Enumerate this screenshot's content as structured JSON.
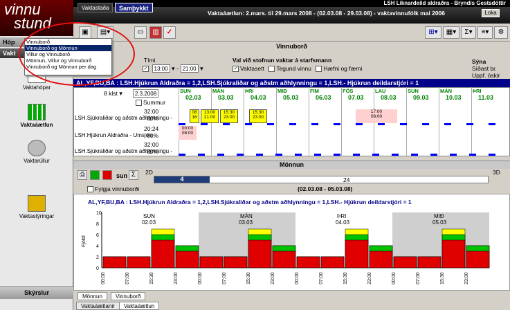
{
  "app": {
    "logo_line1": "vinnu",
    "logo_line2": "stund",
    "window_title": "LSH Líknardeild aldraðra - Bryndís Gestsdóttir"
  },
  "sidebar": {
    "section_home": "Hóp",
    "section_active": "Vakt",
    "items": [
      {
        "label": "Vaktahópar"
      },
      {
        "label": "Vaktaáætlun"
      },
      {
        "label": "Vaktarúllur"
      },
      {
        "label": "Vaktastýringar"
      }
    ],
    "footer": "Skýrslur"
  },
  "tabs": {
    "vaktastada": "Vaktastaða",
    "samthykkt": "Samþykkt"
  },
  "period_title": "Vaktaáætlun: 2.mars. til 29.mars 2008 - (02.03.08 - 29.03.08) - vaktavinnufólk mai 2006",
  "close_label": "Loka",
  "menu": {
    "items": [
      "Vinnuborð",
      "Vinnuborð og Mönnun",
      "Villur og Vinnuborð",
      "Mönnun, Villur og Vinnuborð",
      "Vinnuborð og Mönnun per dag"
    ],
    "selected_index": 1
  },
  "filter": {
    "title": "Vinnuborð",
    "time_label": "Tími",
    "time_from": "13:00",
    "time_to": "21:00",
    "staff_group_label": "Val við stofnun vaktar á starfsmann",
    "opts": [
      "Vaktasett",
      "Tegund vinnu",
      "Hæfni og færni"
    ],
    "show_label": "Sýna",
    "show_opts": [
      "Síðast br.",
      "Uppf. óskir"
    ],
    "weeks": "8 klst",
    "date": "2.3.2008",
    "summary_label": "Summur"
  },
  "banner_top": "AL,YF,BU,BA : LSH.Hjúkrun Aldraðra = 1,2,LSH.Sjúkraliðar og aðstm aðhlynningu = 1,LSH.- Hjúkrun deildarstjóri = 1",
  "days": [
    {
      "d": "SUN",
      "n": "02.03"
    },
    {
      "d": "MÁN",
      "n": "03.03"
    },
    {
      "d": "ÞRI",
      "n": "04.03"
    },
    {
      "d": "MIÐ",
      "n": "05.03"
    },
    {
      "d": "FIM",
      "n": "06.03"
    },
    {
      "d": "FÖS",
      "n": "07.03"
    },
    {
      "d": "LAU",
      "n": "08.03"
    },
    {
      "d": "SUN",
      "n": "09.03"
    },
    {
      "d": "MÁN",
      "n": "10.03"
    },
    {
      "d": "ÞRI",
      "n": "11.03"
    }
  ],
  "staff": [
    {
      "name": "",
      "hours": "32:00",
      "unit": "LSH.Sjúkraliðar og aðstm aðhlynningu -",
      "pct": "80%"
    },
    {
      "name": "",
      "hours": "20:24",
      "unit": "LSH.Hjúkrun Aldraðra - Umsjón",
      "pct": "60%"
    },
    {
      "name": "",
      "hours": "32:00",
      "unit": "LSH.Sjúkraliðar og aðstm aðhlynningu -",
      "pct": "80%"
    }
  ],
  "cells": {
    "c1": "08\n16",
    "c2": "15:30\n23:00",
    "c3": "13:00\n21:00",
    "c4": "15:30\n23:00",
    "c5": "17:00\n08:00",
    "c6": "00:00\n08:00"
  },
  "monnun": {
    "title": "Mönnun",
    "d2": "2D",
    "d3": "3D",
    "slider_val": "4",
    "slider_max": "24",
    "follow_label": "Fylgja vinnuborði",
    "range": "(02.03.08 - 05.03.08)",
    "banner": "AL,YF,BU,BA : LSH.Hjúkrun Aldraðra = 1,2,LSH.Sjúkraliðar og aðstm aðhlynningu = 1,LSH.- Hjúkrun deildarstjóri = 1"
  },
  "chart_data": {
    "type": "area",
    "ylabel": "Fjöldi",
    "ylim": [
      0,
      10
    ],
    "yticks": [
      "0",
      "2",
      "4",
      "6",
      "8",
      "10"
    ],
    "days": [
      "SUN",
      "MÁN",
      "ÞRI",
      "MIÐ"
    ],
    "dates": [
      "02.03",
      "03.03",
      "04.03",
      "05.03"
    ],
    "xticks": [
      "00:00",
      "07:00",
      "15:30",
      "23:00",
      "00:00",
      "07:00",
      "15:30",
      "23:00",
      "00:00",
      "07:00",
      "15:30",
      "23:00",
      "00:00",
      "07:00",
      "15:30",
      "23:00"
    ],
    "series": [
      {
        "name": "",
        "color": "#e00000",
        "values": [
          2,
          2,
          5,
          3,
          2,
          2,
          5,
          3,
          2,
          2,
          5,
          3,
          2,
          2,
          5,
          3
        ]
      },
      {
        "name": "",
        "color": "#00c000",
        "values": [
          2,
          2,
          6,
          4,
          2,
          2,
          6,
          4,
          2,
          2,
          6,
          4,
          2,
          2,
          6,
          4
        ]
      },
      {
        "name": "",
        "color": "#ffff00",
        "values": [
          2,
          2,
          7,
          4,
          2,
          2,
          7,
          4,
          2,
          2,
          7,
          4,
          2,
          2,
          7,
          4
        ]
      }
    ]
  },
  "bottom_tabs": [
    "Mönnun",
    "Vinnuborð"
  ],
  "bottom_tabs2": [
    "Vaktaáætlanir",
    "Vaktaáætlun"
  ],
  "colors": {
    "accent": "#00008b",
    "header": "#1a237e",
    "alert": "#e01010"
  }
}
